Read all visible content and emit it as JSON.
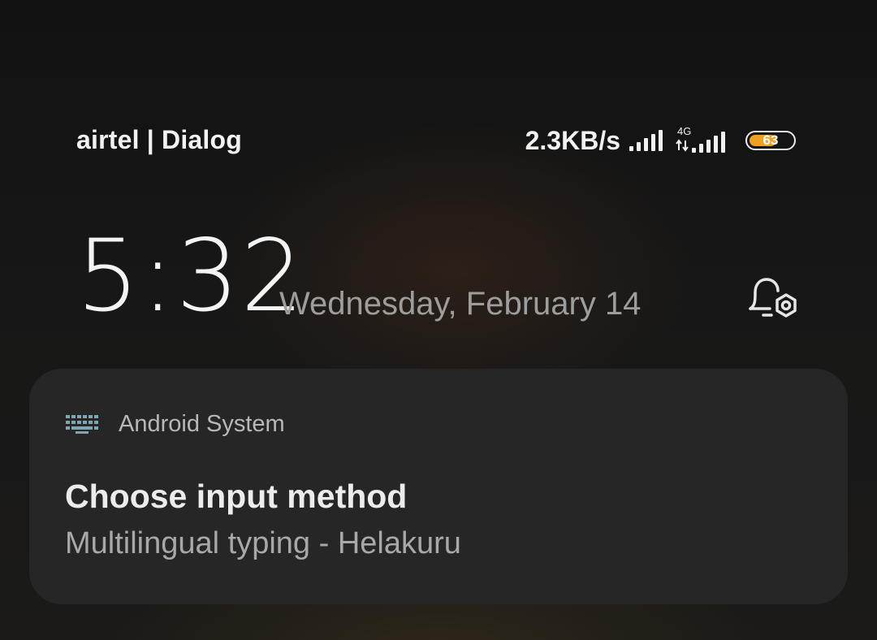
{
  "status_bar": {
    "carrier": "airtel | Dialog",
    "net_speed": "2.3KB/s",
    "sim1_icon": "signal-bars-icon",
    "sim2_network": "4G",
    "sim2_icon": "signal-bars-icon",
    "battery_level": "63",
    "battery_fraction": 0.63,
    "battery_color": "#f0a020"
  },
  "lockscreen": {
    "time": "5:32",
    "date": "Wednesday, February 14",
    "settings_icon": "bell-gear-icon"
  },
  "notification": {
    "app_icon": "keyboard-icon",
    "app_name": "Android System",
    "title": "Choose input method",
    "text": "Multilingual typing - Helakuru"
  }
}
